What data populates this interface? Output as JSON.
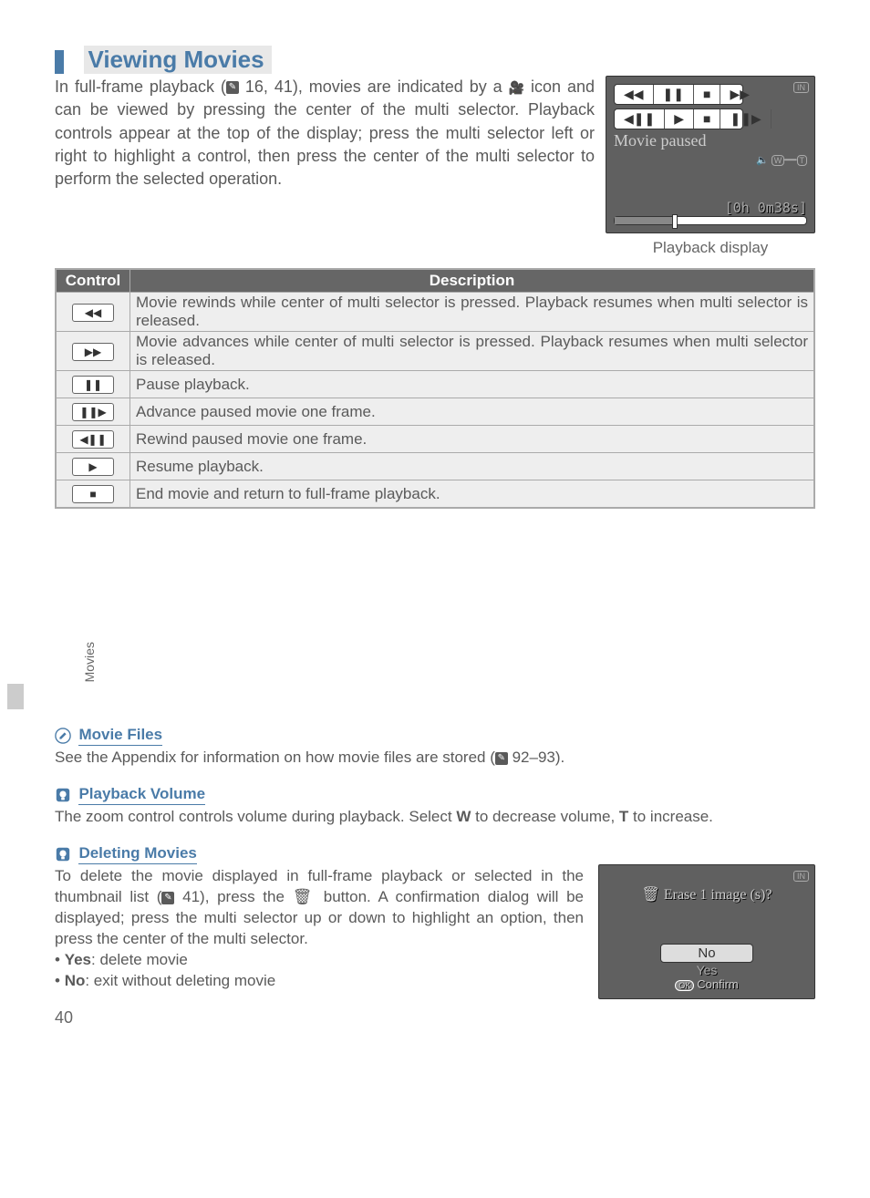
{
  "heading": "Viewing Movies",
  "intro": "In full-frame playback (  16, 41), movies are indicated by a  icon and can be viewed by pressing the center of the multi selector.  Playback controls appear at the top of the display; press the multi selector left or right to highlight a control, then press the center of the multi selector to perform the selected operation.",
  "lcd": {
    "status": "Movie paused",
    "time": "0h 0m38s",
    "in_badge": "IN"
  },
  "caption": "Playback display",
  "table": {
    "headers": [
      "Control",
      "Description"
    ],
    "rows": [
      {
        "icon": "◀◀",
        "desc": "Movie rewinds while center of multi selector is pressed.  Playback resumes when multi selector is released."
      },
      {
        "icon": "▶▶",
        "desc": "Movie advances while center of multi selector is pressed.  Playback resumes when multi selector is released."
      },
      {
        "icon": "❚❚",
        "desc": "Pause playback."
      },
      {
        "icon": "❚❚▶",
        "desc": "Advance paused movie one frame."
      },
      {
        "icon": "◀❚❚",
        "desc": "Rewind paused movie one frame."
      },
      {
        "icon": "▶",
        "desc": "Resume playback."
      },
      {
        "icon": "■",
        "desc": "End movie and return to full-frame playback."
      }
    ]
  },
  "side_label": "Movies",
  "notes": {
    "movie_files": {
      "title": "Movie Files",
      "text_pre": "See the Appendix for information on how movie files are stored (",
      "text_post": " 92–93)."
    },
    "playback_volume": {
      "title": "Playback Volume",
      "text_pre": "The zoom control controls volume during playback.  Select ",
      "bold_w": "W",
      "text_mid": " to decrease volume, ",
      "bold_t": "T",
      "text_post": " to increase."
    },
    "deleting": {
      "title": "Deleting Movies",
      "text_pre": "To delete the movie displayed in full-frame playback or selected in the thumbnail list (",
      "text_mid": " 41), press the ",
      "text_post": " button.  A confirmation dialog will be displayed; press the multi selector up or down to highlight an option, then press the center of the multi selector.",
      "bullets": [
        {
          "b": "Yes",
          "t": ": delete movie"
        },
        {
          "b": "No",
          "t": ": exit without deleting movie"
        }
      ]
    }
  },
  "dialog": {
    "title": "Erase 1 image (s)?",
    "no": "No",
    "yes": "Yes",
    "confirm": "Confirm",
    "ok": "OK",
    "in_badge": "IN"
  },
  "page": "40"
}
